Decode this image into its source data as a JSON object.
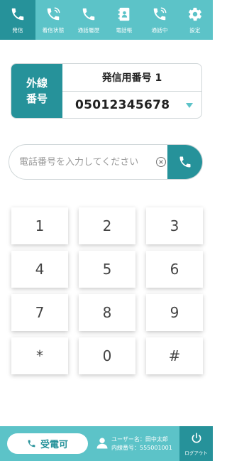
{
  "nav": {
    "items": [
      {
        "label": "発信",
        "icon": "phone-icon",
        "active": true
      },
      {
        "label": "着信状態",
        "icon": "phone-ringing-icon",
        "active": false
      },
      {
        "label": "通話履歴",
        "icon": "call-history-icon",
        "active": false
      },
      {
        "label": "電話帳",
        "icon": "phonebook-icon",
        "active": false
      },
      {
        "label": "通話中",
        "icon": "in-call-icon",
        "active": false
      },
      {
        "label": "設定",
        "icon": "gear-icon",
        "active": false
      }
    ]
  },
  "line": {
    "label_line1": "外線",
    "label_line2": "番号",
    "name": "発信用番号 1",
    "number": "05012345678"
  },
  "dial": {
    "placeholder": "電話番号を入力してください"
  },
  "keypad": {
    "keys": [
      "1",
      "2",
      "3",
      "4",
      "5",
      "6",
      "7",
      "8",
      "9",
      "*",
      "0",
      "#"
    ]
  },
  "footer": {
    "receive_label": "受電可",
    "user_line": "ユーザー名：田中太郎",
    "ext_line": "内線番号：555001001",
    "logout_label": "ログアウト"
  },
  "colors": {
    "primary": "#5cc3c8",
    "primary_dark": "#26929a"
  }
}
